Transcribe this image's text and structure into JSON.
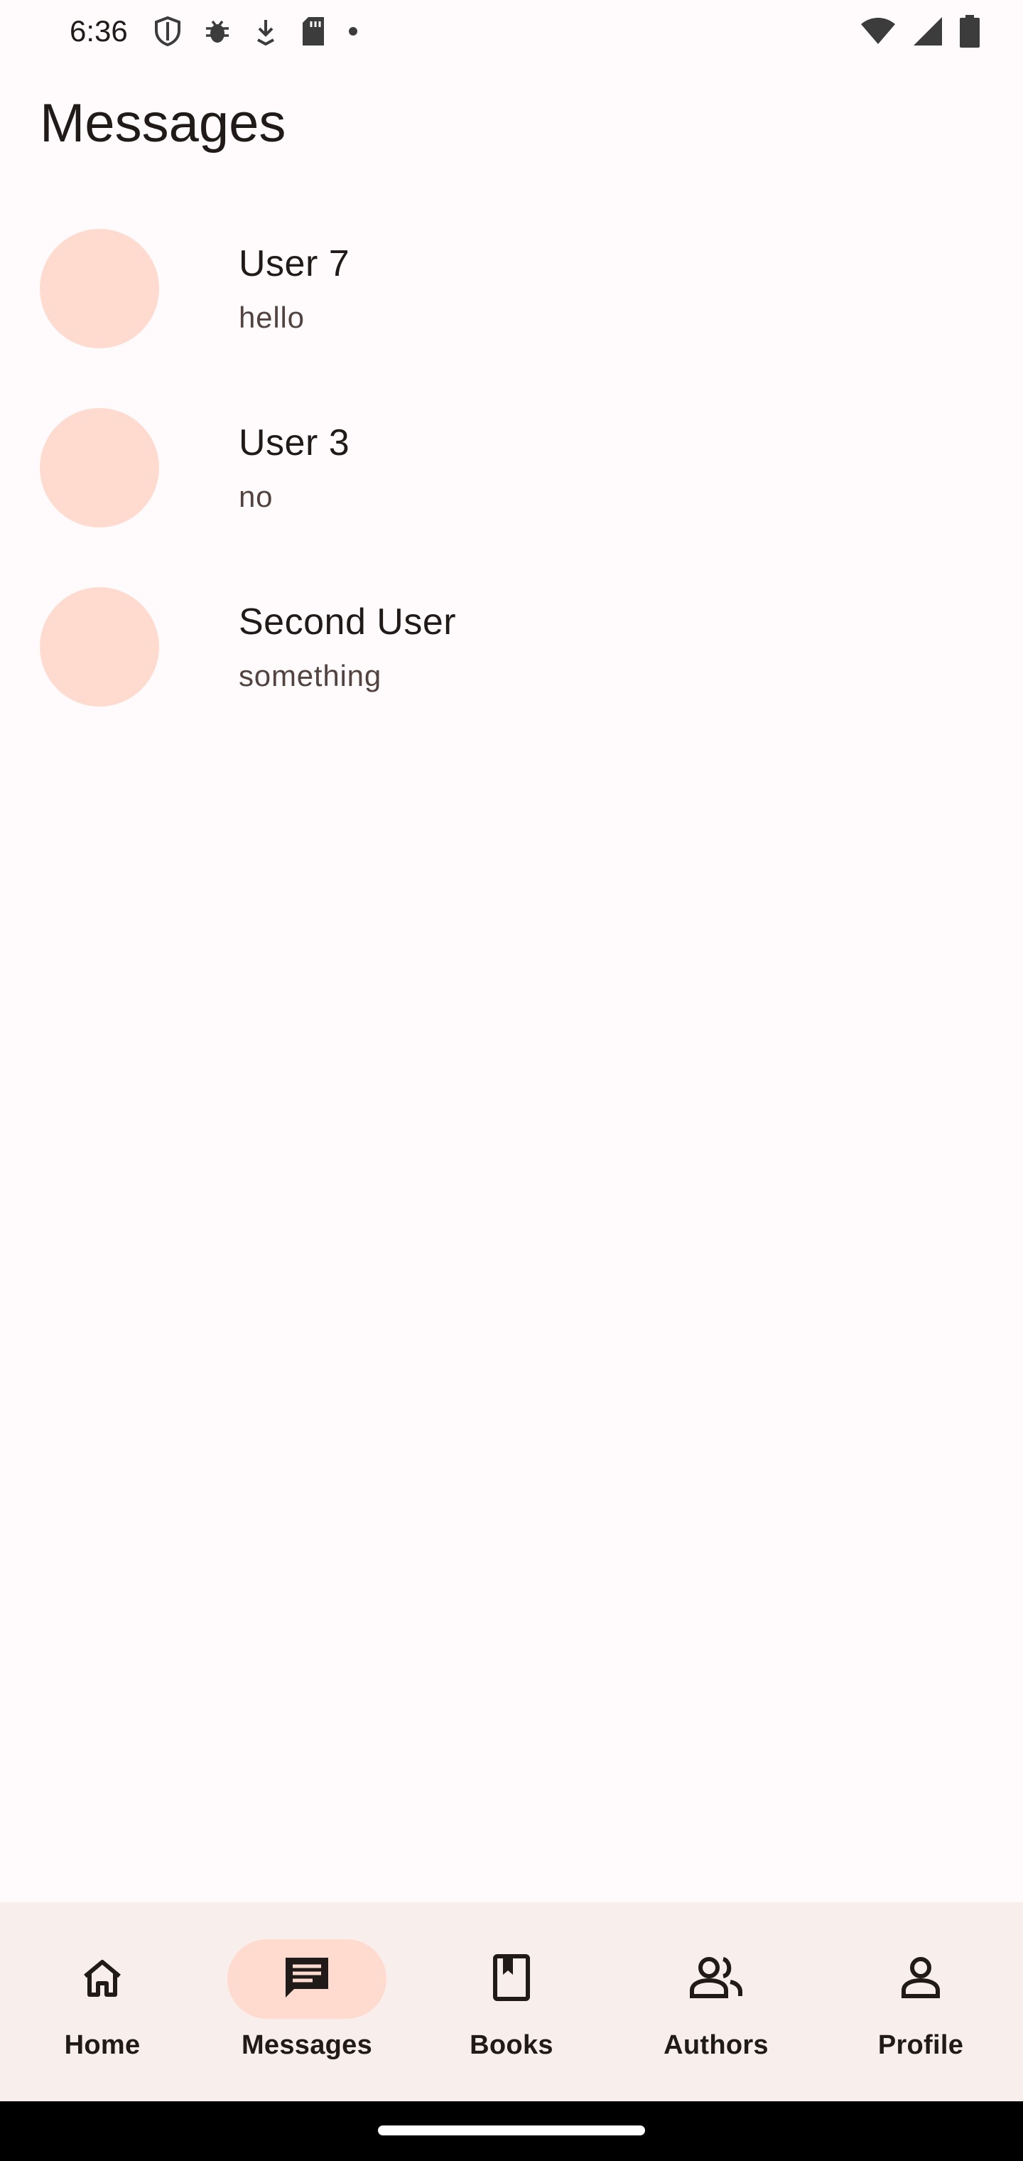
{
  "status_bar": {
    "time": "6:36",
    "left_icons": [
      "shield-icon",
      "bug-icon",
      "download-icon",
      "sd-card-icon",
      "dot-icon"
    ],
    "right_icons": [
      "wifi-icon",
      "signal-icon",
      "battery-icon"
    ]
  },
  "header": {
    "title": "Messages"
  },
  "conversations": [
    {
      "name": "User 7",
      "preview": "hello"
    },
    {
      "name": "User 3",
      "preview": "no"
    },
    {
      "name": "Second User",
      "preview": "something"
    }
  ],
  "bottom_nav": {
    "items": [
      {
        "label": "Home",
        "icon": "home-icon",
        "active": false
      },
      {
        "label": "Messages",
        "icon": "message-icon",
        "active": true
      },
      {
        "label": "Books",
        "icon": "book-icon",
        "active": false
      },
      {
        "label": "Authors",
        "icon": "people-icon",
        "active": false
      },
      {
        "label": "Profile",
        "icon": "person-icon",
        "active": false
      }
    ]
  },
  "colors": {
    "background": "#fffbfd",
    "avatar": "#ffdbcf",
    "nav_background": "#f8eeeb",
    "active_indicator": "#ffdbcf",
    "text": "#201a19",
    "secondary_text": "#534340"
  }
}
